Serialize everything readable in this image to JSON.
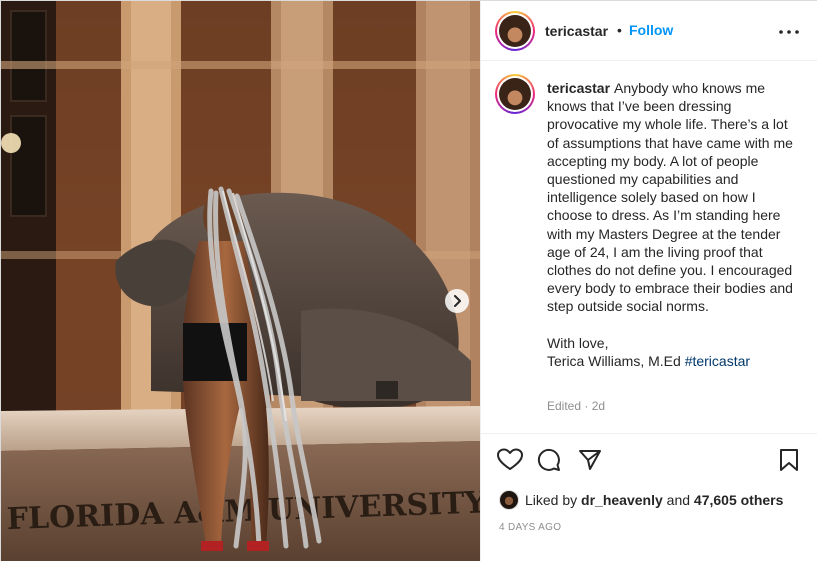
{
  "post": {
    "username": "tericastar",
    "separator": "•",
    "follow_label": "Follow",
    "more_label": "•••"
  },
  "caption": {
    "username": "tericastar",
    "paragraph1": "Anybody who knows me knows that I’ve been dressing provocative my whole life. There’s a lot of assumptions that have came with me accepting my body. A lot of people questioned my capabilities and intelligence solely based on how I choose to dress. As I’m standing here with my Masters Degree at the tender age of 24, I am the living proof that clothes do not define you. I encouraged every body to embrace their bodies and step outside social norms.",
    "signoff": "With love,",
    "signature": "Terica Williams, M.Ed",
    "hashtag": "#tericastar",
    "edited": "Edited · 2d"
  },
  "actions": {
    "like_icon": "heart-icon",
    "comment_icon": "comment-icon",
    "share_icon": "paper-plane-icon",
    "save_icon": "bookmark-icon"
  },
  "likes": {
    "prefix": "Liked by",
    "user": "dr_heavenly",
    "middle": "and",
    "count": "47,605 others"
  },
  "timestamp": "4 DAYS AGO",
  "photo": {
    "sign_text": "FLORIDA A&M UNIVERSITY",
    "next_icon": "chevron-right-icon"
  },
  "colors": {
    "link_blue": "#0095f6",
    "hashtag": "#00376b",
    "muted": "#8e8e8e"
  }
}
